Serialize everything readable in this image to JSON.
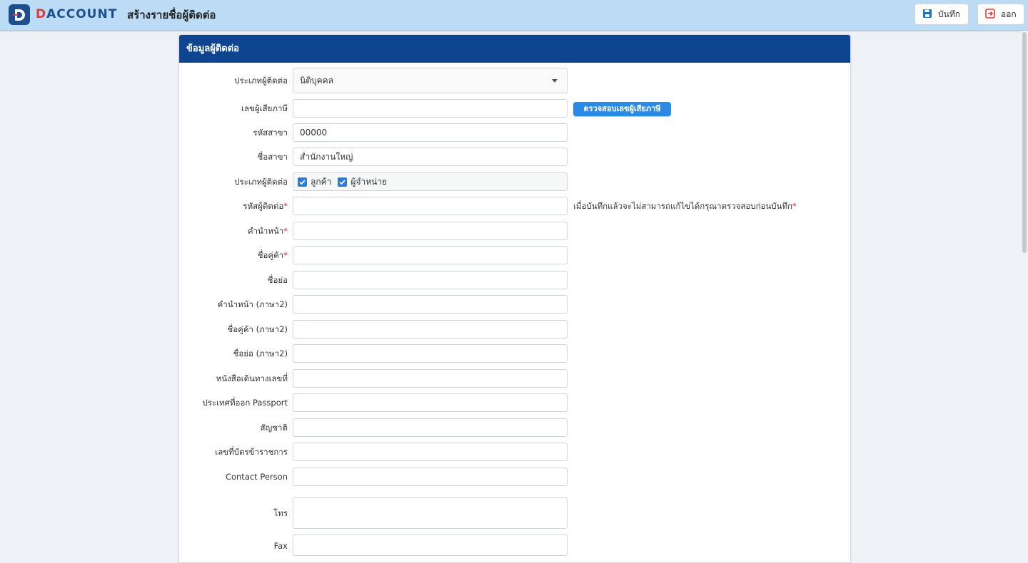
{
  "header": {
    "logo_text_d": "D",
    "logo_text_rest": "ACCOUNT",
    "page_title": "สร้างรายชื่อผู้ติดต่อ",
    "save_label": "บันทึก",
    "exit_label": "ออก",
    "accent_color": "#1d4f8f",
    "save_icon": "floppy-disk-icon",
    "exit_icon": "exit-icon"
  },
  "panel": {
    "title": "ข้อมูลผู้ติดต่อ",
    "header_color": "#0d4590"
  },
  "form": {
    "contact_type_label": "ประเภทผู้ติดต่อ",
    "contact_type_value": "นิติบุคคล",
    "tax_id_label": "เลขผู้เสียภาษี",
    "tax_id_value": "",
    "verify_tax_button": "ตรวจสอบเลขผู้เสียภาษี",
    "branch_code_label": "รหัสสาขา",
    "branch_code_value": "00000",
    "branch_name_label": "ชื่อสาขา",
    "branch_name_value": "สำนักงานใหญ่",
    "contact_kind_label": "ประเภทผู้ติดต่อ",
    "customer_label": "ลูกค้า",
    "customer_checked": true,
    "supplier_label": "ผู้จำหน่าย",
    "supplier_checked": true,
    "contact_code_label": "รหัสผู้ติดต่อ",
    "required_mark": "*",
    "contact_code_value": "",
    "contact_code_note": "เมื่อบันทึกแล้วจะไม่สามารถแก้ไขได้กรุณาตรวจสอบก่อนบันทึก",
    "prefix_label": "คำนำหน้า",
    "prefix_value": "",
    "partner_name_label": "ชื่อคู่ค้า",
    "partner_name_value": "",
    "short_name_label": "ชื่อย่อ",
    "short_name_value": "",
    "prefix2_label": "คำนำหน้า (ภาษา2)",
    "prefix2_value": "",
    "partner_name2_label": "ชื่อคู่ค้า (ภาษา2)",
    "partner_name2_value": "",
    "short_name2_label": "ชื่อย่อ (ภาษา2)",
    "short_name2_value": "",
    "passport_no_label": "หนังสือเดินทางเลขที่",
    "passport_no_value": "",
    "passport_country_label": "ประเทศที่ออก Passport",
    "passport_country_value": "",
    "nationality_label": "สัญชาติ",
    "nationality_value": "",
    "gov_id_label": "เลขที่บัตรข้าราชการ",
    "gov_id_value": "",
    "contact_person_label": "Contact Person",
    "contact_person_value": "",
    "phone_label": "โทร",
    "phone_value": "",
    "fax_label": "Fax",
    "fax_value": ""
  }
}
